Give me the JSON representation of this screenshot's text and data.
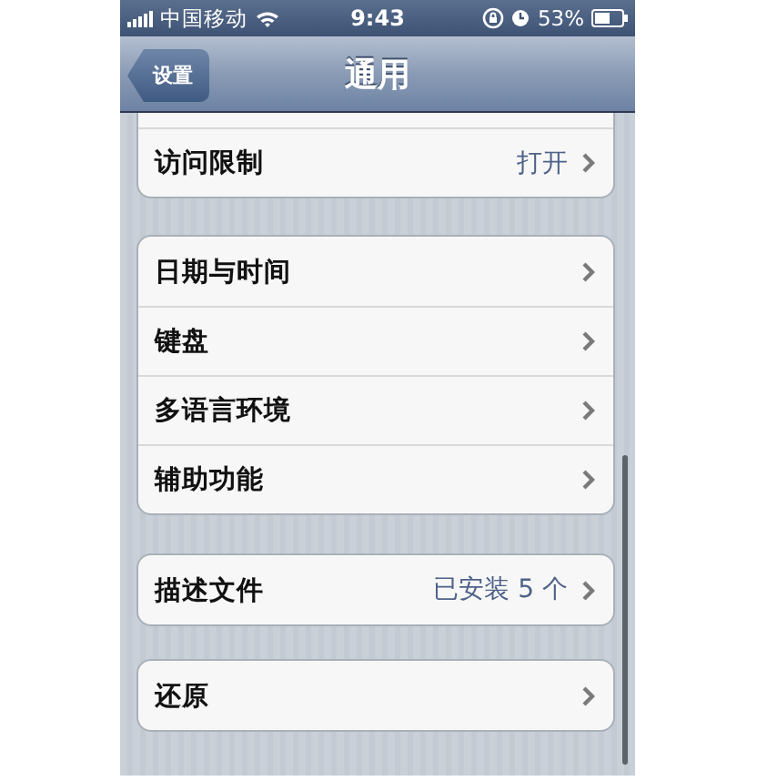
{
  "status_bar": {
    "carrier": "中国移动",
    "time": "9:43",
    "battery": "53%"
  },
  "nav_bar": {
    "back_button": "设置",
    "title": "通用"
  },
  "groups": [
    {
      "rows": [
        {
          "label": "访问限制",
          "value": "打开"
        }
      ]
    },
    {
      "rows": [
        {
          "label": "日期与时间"
        },
        {
          "label": "键盘"
        },
        {
          "label": "多语言环境"
        },
        {
          "label": "辅助功能"
        }
      ]
    },
    {
      "rows": [
        {
          "label": "描述文件",
          "value": "已安装 5 个"
        }
      ]
    },
    {
      "rows": [
        {
          "label": "还原"
        }
      ]
    }
  ]
}
